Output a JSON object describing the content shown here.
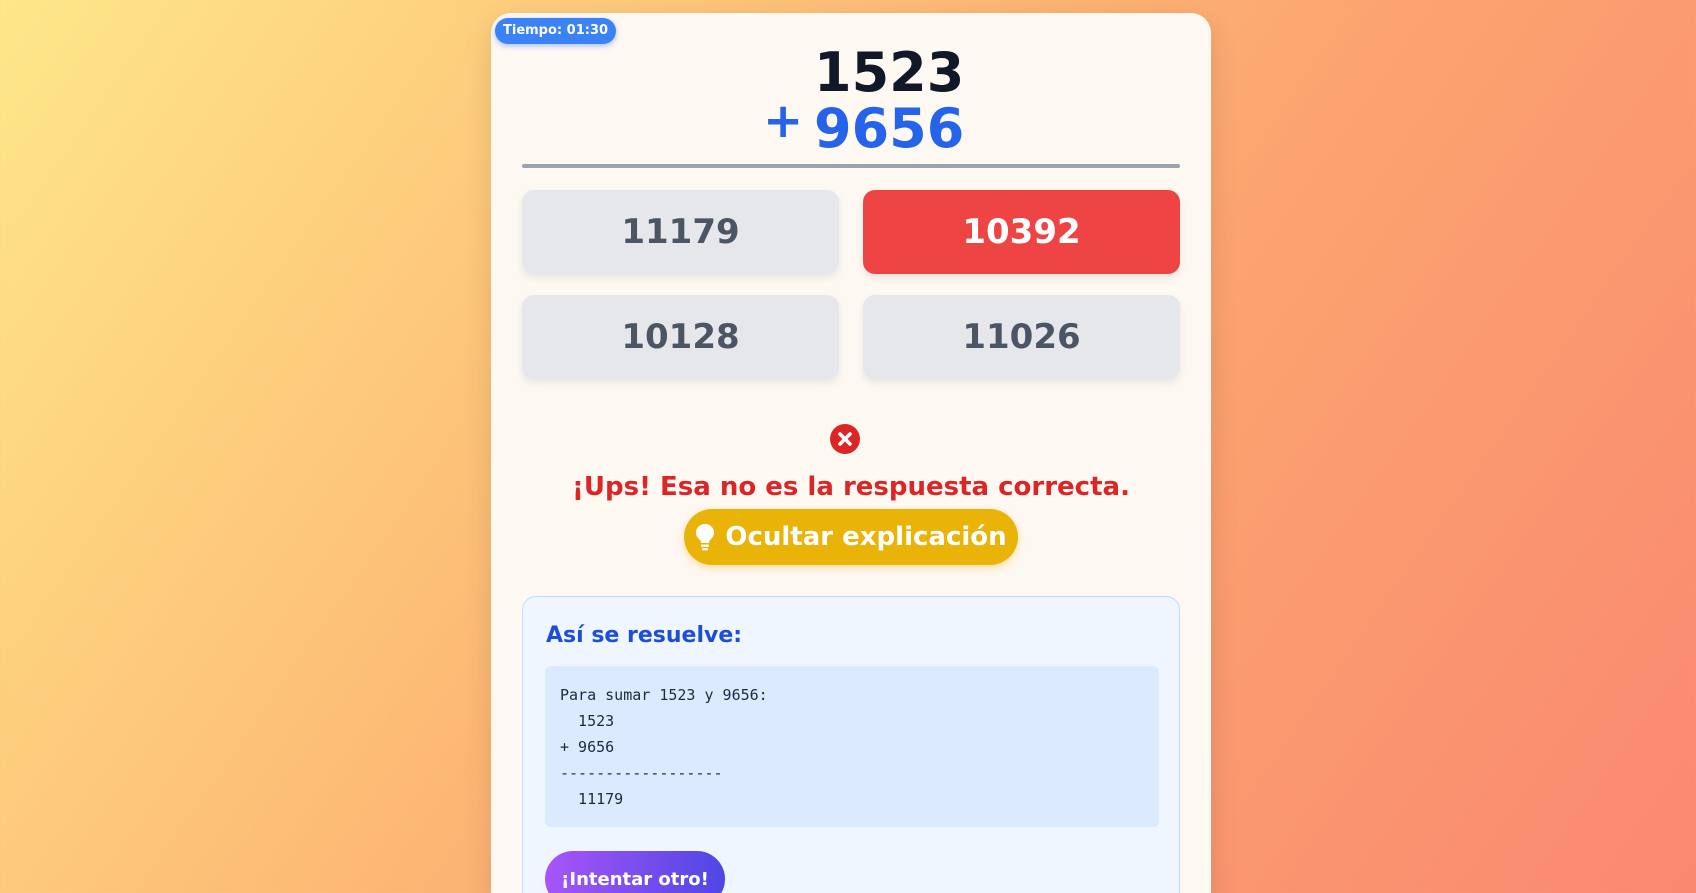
{
  "timer": {
    "label": "Tiempo: 01:30"
  },
  "problem": {
    "operand1": "1523",
    "operator": "+",
    "operand2": "9656"
  },
  "options": [
    {
      "value": "11179",
      "state": "default"
    },
    {
      "value": "10392",
      "state": "wrong"
    },
    {
      "value": "10128",
      "state": "default"
    },
    {
      "value": "11026",
      "state": "default"
    }
  ],
  "feedback": {
    "icon": "x-circle-icon",
    "message": "¡Ups! Esa no es la respuesta correcta."
  },
  "toggle_explanation": {
    "icon": "lightbulb-icon",
    "label": "Ocultar explicación"
  },
  "explanation": {
    "title": "Así se resuelve:",
    "lines": [
      "Para sumar 1523 y 9656:",
      "  1523",
      "+ 9656",
      "------------------",
      "  11179"
    ]
  },
  "retry": {
    "label": "¡Intentar otro!"
  },
  "colors": {
    "accent_blue": "#2563eb",
    "wrong_red": "#ef4444",
    "hint_yellow": "#eab308",
    "retry_gradient_start": "#a855f7",
    "retry_gradient_end": "#4f46e5"
  }
}
